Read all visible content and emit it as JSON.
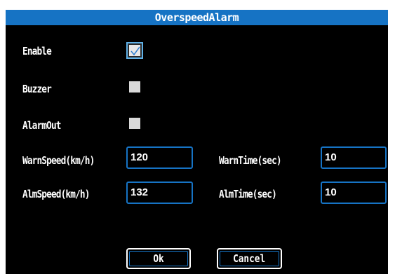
{
  "dialog": {
    "title": "OverspeedAlarm"
  },
  "options": {
    "enable": {
      "label": "Enable",
      "checked": true
    },
    "buzzer": {
      "label": "Buzzer",
      "checked": false
    },
    "alarm_out": {
      "label": "AlarmOut",
      "checked": false
    }
  },
  "fields": {
    "warn_speed": {
      "label": "WarnSpeed(km/h)",
      "value": "120"
    },
    "warn_time": {
      "label": "WarnTime(sec)",
      "value": "10"
    },
    "alm_speed": {
      "label": "AlmSpeed(km/h)",
      "value": "132"
    },
    "alm_time": {
      "label": "AlmTime(sec)",
      "value": "10"
    }
  },
  "buttons": {
    "ok": "Ok",
    "cancel": "Cancel"
  },
  "colors": {
    "accent": "#1673c4",
    "checkbox_border": "#5fb0e6",
    "background": "#000000",
    "text": "#ffffff"
  }
}
